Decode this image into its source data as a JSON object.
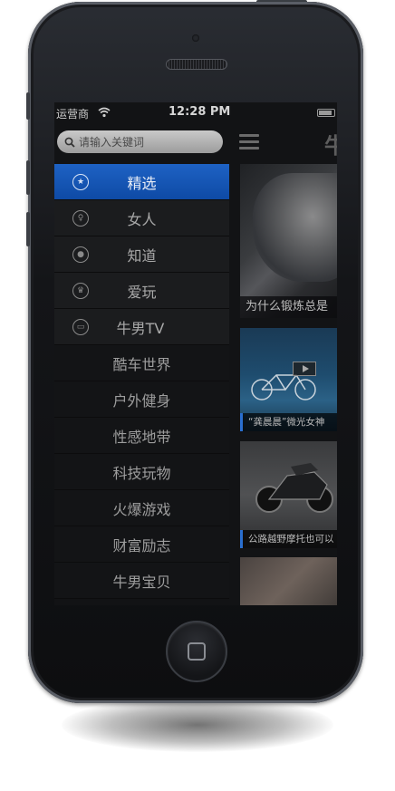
{
  "status_bar": {
    "carrier": "运营商",
    "time": "12:28 PM"
  },
  "search": {
    "placeholder": "请输入关键词"
  },
  "header": {
    "title": "牛"
  },
  "side_menu": {
    "items": [
      {
        "label": "精选",
        "icon": "star-icon",
        "active": true
      },
      {
        "label": "女人",
        "icon": "female-icon",
        "active": false
      },
      {
        "label": "知道",
        "icon": "bulb-icon",
        "active": false
      },
      {
        "label": "爱玩",
        "icon": "crown-icon",
        "active": false
      },
      {
        "label": "牛男TV",
        "icon": "tv-icon",
        "active": false
      }
    ],
    "sub_items": [
      {
        "label": "酷车世界"
      },
      {
        "label": "户外健身"
      },
      {
        "label": "性感地带"
      },
      {
        "label": "科技玩物"
      },
      {
        "label": "火爆游戏"
      },
      {
        "label": "财富励志"
      },
      {
        "label": "牛男宝贝"
      }
    ]
  },
  "content": {
    "cards": [
      {
        "caption": "为什么锻炼总是"
      },
      {
        "caption": "“龚晨晨”微光女神"
      },
      {
        "caption": "公路越野摩托也可以"
      },
      {
        "caption": ""
      }
    ]
  },
  "colors": {
    "active": "#1457b8",
    "menu_bg": "#1b1c1e",
    "sub_bg": "#131416"
  }
}
